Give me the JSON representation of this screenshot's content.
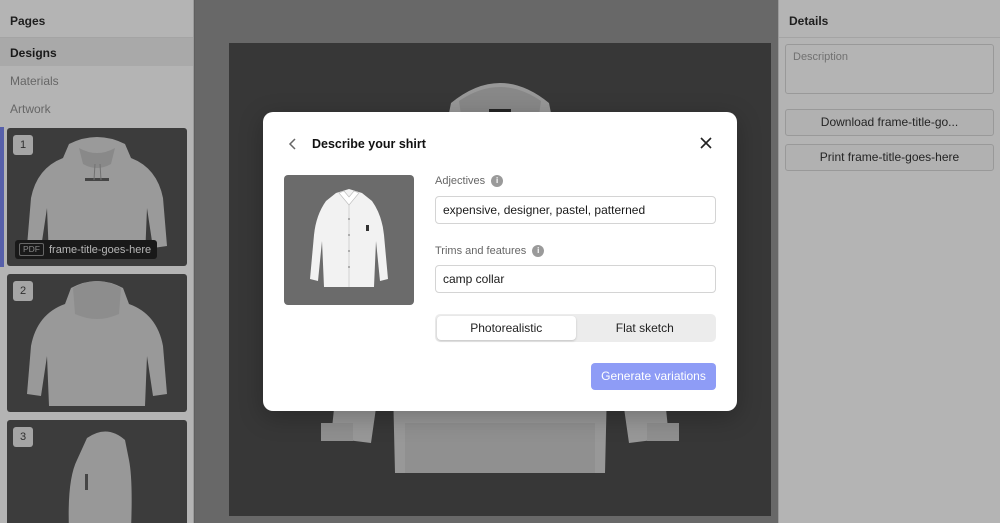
{
  "sidebar": {
    "title": "Pages",
    "items": [
      {
        "label": "Designs"
      },
      {
        "label": "Materials"
      },
      {
        "label": "Artwork"
      }
    ],
    "thumbnails": [
      {
        "number": "1",
        "pdf_tag": "PDF",
        "frame_title": "frame-title-goes-here"
      },
      {
        "number": "2"
      },
      {
        "number": "3"
      }
    ]
  },
  "details": {
    "title": "Details",
    "description_placeholder": "Description",
    "download_label": "Download frame-title-go...",
    "print_label": "Print frame-title-goes-here"
  },
  "modal": {
    "title": "Describe your shirt",
    "adjectives_label": "Adjectives",
    "adjectives_value": "expensive, designer, pastel, patterned",
    "trims_label": "Trims and features",
    "trims_value": "camp collar",
    "style_options": [
      "Photorealistic",
      "Flat sketch"
    ],
    "selected_style": "Photorealistic",
    "generate_label": "Generate variations",
    "info_glyph": "i"
  },
  "colors": {
    "accent": "#6f7df0",
    "generate_button": "#8e9cf6",
    "canvas_frame": "#3f3f3f"
  }
}
